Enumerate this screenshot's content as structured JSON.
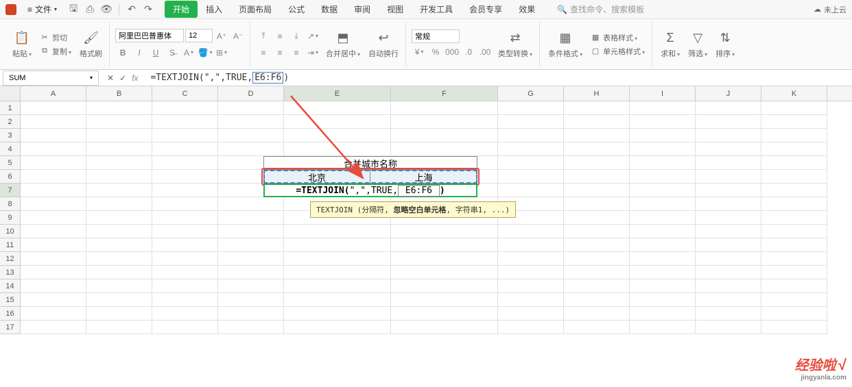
{
  "titlebar": {
    "file_menu": "文件",
    "cloud_status": "未上云"
  },
  "ribbon_tabs": {
    "start": "开始",
    "insert": "插入",
    "page_layout": "页面布局",
    "formulas": "公式",
    "data": "数据",
    "review": "审阅",
    "view": "视图",
    "dev_tools": "开发工具",
    "member": "会员专享",
    "effects": "效果",
    "search_placeholder": "查找命令、搜索模板"
  },
  "ribbon": {
    "paste": "粘贴",
    "cut": "剪切",
    "copy": "复制",
    "format_painter": "格式刷",
    "font_name": "阿里巴巴普惠体",
    "font_size": "12",
    "merge_center": "合并居中",
    "wrap_text": "自动换行",
    "number_format": "常规",
    "type_convert": "类型转换",
    "cond_format": "条件格式",
    "table_style": "表格样式",
    "cell_style": "单元格样式",
    "sum": "求和",
    "filter": "筛选",
    "sort": "排序"
  },
  "formula_bar": {
    "name_box": "SUM",
    "formula_prefix": "=TEXTJOIN(\",\",TRUE,",
    "formula_range": "E6:F6",
    "formula_suffix": ")"
  },
  "columns": [
    "A",
    "B",
    "C",
    "D",
    "E",
    "F",
    "G",
    "H",
    "I",
    "J",
    "K"
  ],
  "rows": [
    "1",
    "2",
    "3",
    "4",
    "5",
    "6",
    "7",
    "8",
    "9",
    "10",
    "11",
    "12",
    "13",
    "14",
    "15",
    "16",
    "17"
  ],
  "cells": {
    "title": "合并城市名称",
    "e6": "北京",
    "f6": "上海",
    "formula_text1": "=TEXTJOIN(",
    "formula_text2": "\",\",TRUE,",
    "formula_text3": " E6:F6 ",
    "formula_text4": ")"
  },
  "tooltip": {
    "t1": "TEXTJOIN (分隔符, ",
    "t2": "忽略空白单元格",
    "t3": ", 字符串1, ...)"
  },
  "watermark": {
    "main": "经验啦",
    "check": "√",
    "sub": "jingyanla.com"
  }
}
